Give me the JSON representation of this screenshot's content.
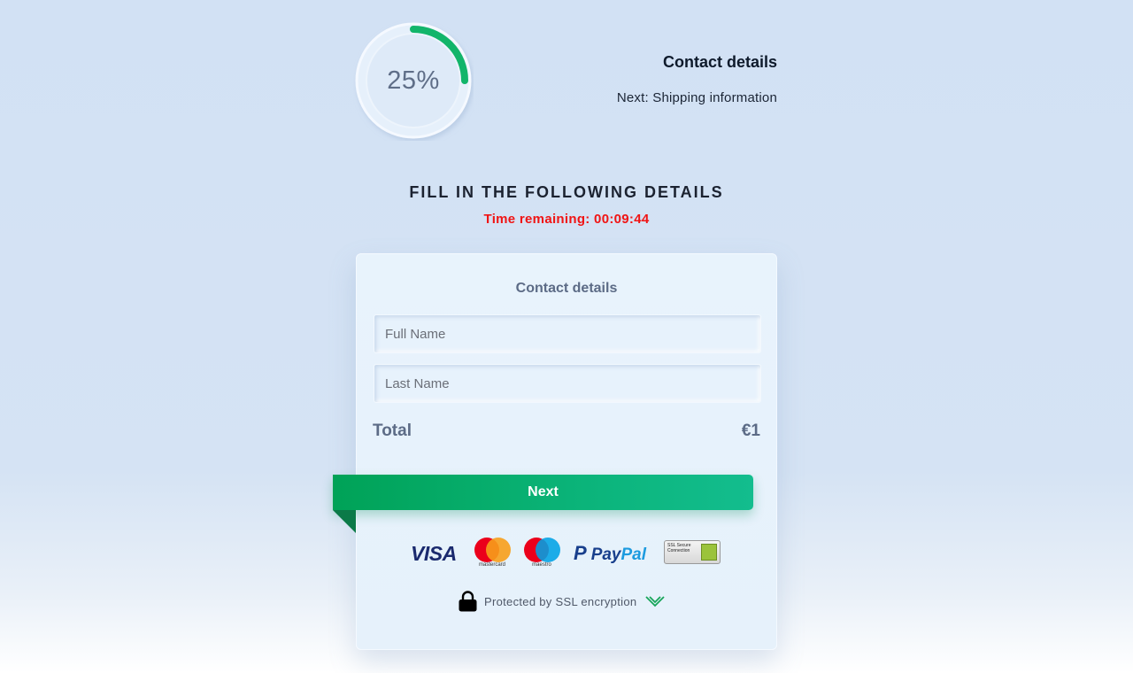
{
  "progress": {
    "percent_label": "25%",
    "fraction": 0.25,
    "color": "#12b56a"
  },
  "steps": {
    "current": "Contact details",
    "next": "Next: Shipping information"
  },
  "heading": "FILL IN THE FOLLOWING DETAILS",
  "timer": "Time remaining: 00:09:44",
  "card": {
    "title": "Contact details",
    "full_name_placeholder": "Full Name",
    "last_name_placeholder": "Last Name",
    "total_label": "Total",
    "total_value": "€1",
    "next_button": "Next"
  },
  "payment_logos": {
    "visa": "VISA",
    "mastercard": "mastercard",
    "maestro": "maestro",
    "paypal_pay": "Pay",
    "paypal_pal": "Pal",
    "ssl_badge": "SSL Secure Connection"
  },
  "security": {
    "text": "Protected by SSL encryption",
    "lock_icon": "lock-icon",
    "check_icon": "double-chevron-down-icon"
  },
  "colors": {
    "accent_green": "#0bb47a",
    "timer_red": "#f01414",
    "muted_text": "#5c6b86"
  }
}
